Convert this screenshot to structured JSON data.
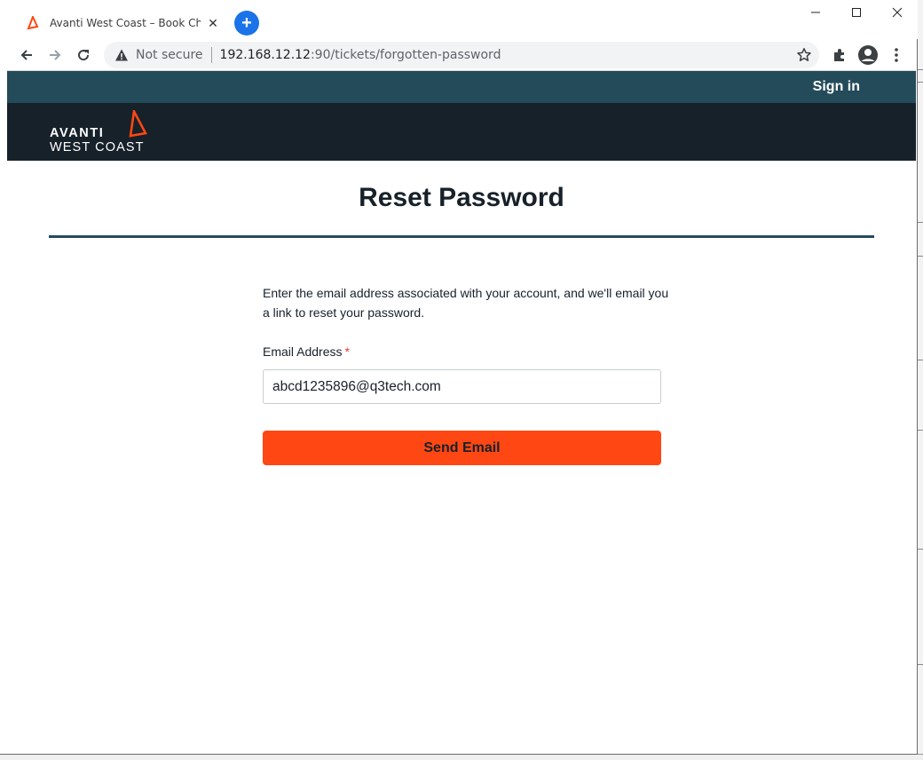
{
  "browser": {
    "tab": {
      "title": "Avanti West Coast – Book Cheap"
    },
    "address": {
      "security_label": "Not secure",
      "url_host": "192.168.12.12",
      "url_path": ":90/tickets/forgotten-password"
    }
  },
  "site": {
    "header": {
      "signin_label": "Sign in"
    },
    "logo": {
      "line1": "AVANTI",
      "line2": "WEST COAST"
    }
  },
  "reset": {
    "title": "Reset Password",
    "instructions": "Enter the email address associated with your account, and we'll email you a link to reset your password.",
    "email_label": "Email Address",
    "required_marker": "*",
    "email_value": "abcd1235896@q3tech.com",
    "send_label": "Send Email"
  },
  "colors": {
    "header_teal": "#244b5a",
    "brand_navy": "#17212a",
    "accent_orange": "#ff4713"
  }
}
